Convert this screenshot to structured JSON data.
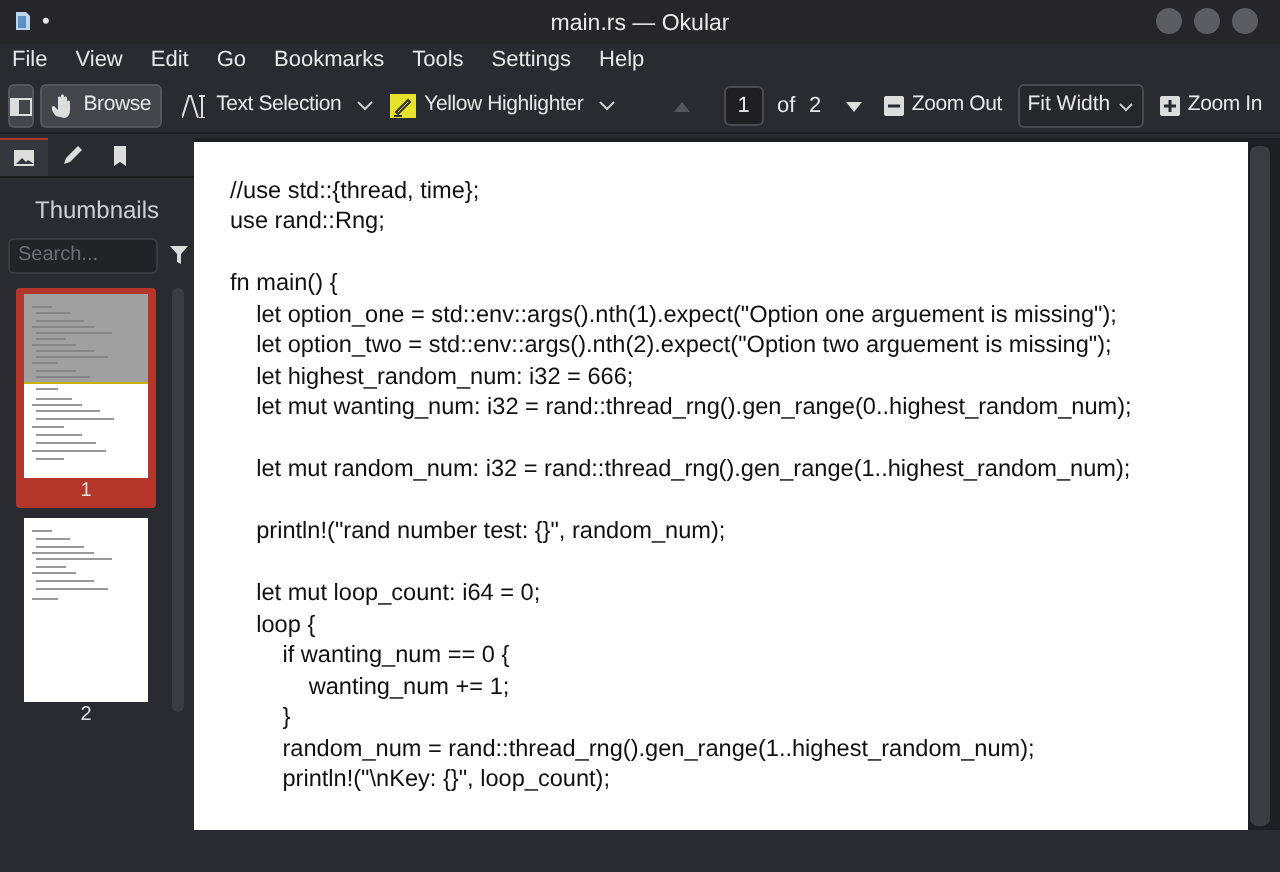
{
  "window": {
    "title": "main.rs — Okular",
    "pin": "•"
  },
  "menu": [
    "File",
    "View",
    "Edit",
    "Go",
    "Bookmarks",
    "Tools",
    "Settings",
    "Help"
  ],
  "toolbar": {
    "tools": [
      {
        "label": "Browse",
        "kind": "hand",
        "selected": true,
        "dropdown": false
      },
      {
        "label": "Text Selection",
        "kind": "text",
        "selected": false,
        "dropdown": true
      },
      {
        "label": "Yellow Highlighter",
        "kind": "highlighter",
        "selected": false,
        "dropdown": true
      }
    ],
    "page": "1",
    "of": "of",
    "total": "2",
    "prev_disabled": true,
    "zoom_out": "Zoom Out",
    "fit": "Fit Width",
    "zoom_in": "Zoom In"
  },
  "sidebar": {
    "tabs": [
      {
        "kind": "thumbnails",
        "selected": true
      },
      {
        "kind": "annotations",
        "selected": false
      },
      {
        "kind": "bookmarks",
        "selected": false
      }
    ],
    "heading": "Thumbnails",
    "search": {
      "placeholder": "Search..."
    },
    "thumbnails": [
      {
        "label": "1",
        "selected": true,
        "visible": true
      },
      {
        "label": "2",
        "selected": false,
        "visible": false
      }
    ]
  },
  "document": {
    "blocks": [
      [
        "//use std::{thread, time};",
        "use rand::Rng;"
      ],
      [
        "fn main() {",
        "    let option_one = std::env::args().nth(1).expect(\"Option one arguement is missing\");",
        "    let option_two = std::env::args().nth(2).expect(\"Option two arguement is missing\");",
        "    let highest_random_num: i32 = 666;",
        "    let mut wanting_num: i32 = rand::thread_rng().gen_range(0..highest_random_num);"
      ],
      [
        "    let mut random_num: i32 = rand::thread_rng().gen_range(1..highest_random_num);"
      ],
      [
        "    println!(\"rand number test: {}\", random_num);"
      ],
      [
        "    let mut loop_count: i64 = 0;",
        "    loop {",
        "        if wanting_num == 0 {",
        "            wanting_num += 1;",
        "        }",
        "        random_num = rand::thread_rng().gen_range(1..highest_random_num);",
        "        println!(\"\\nKey: {}\", loop_count);"
      ]
    ]
  }
}
